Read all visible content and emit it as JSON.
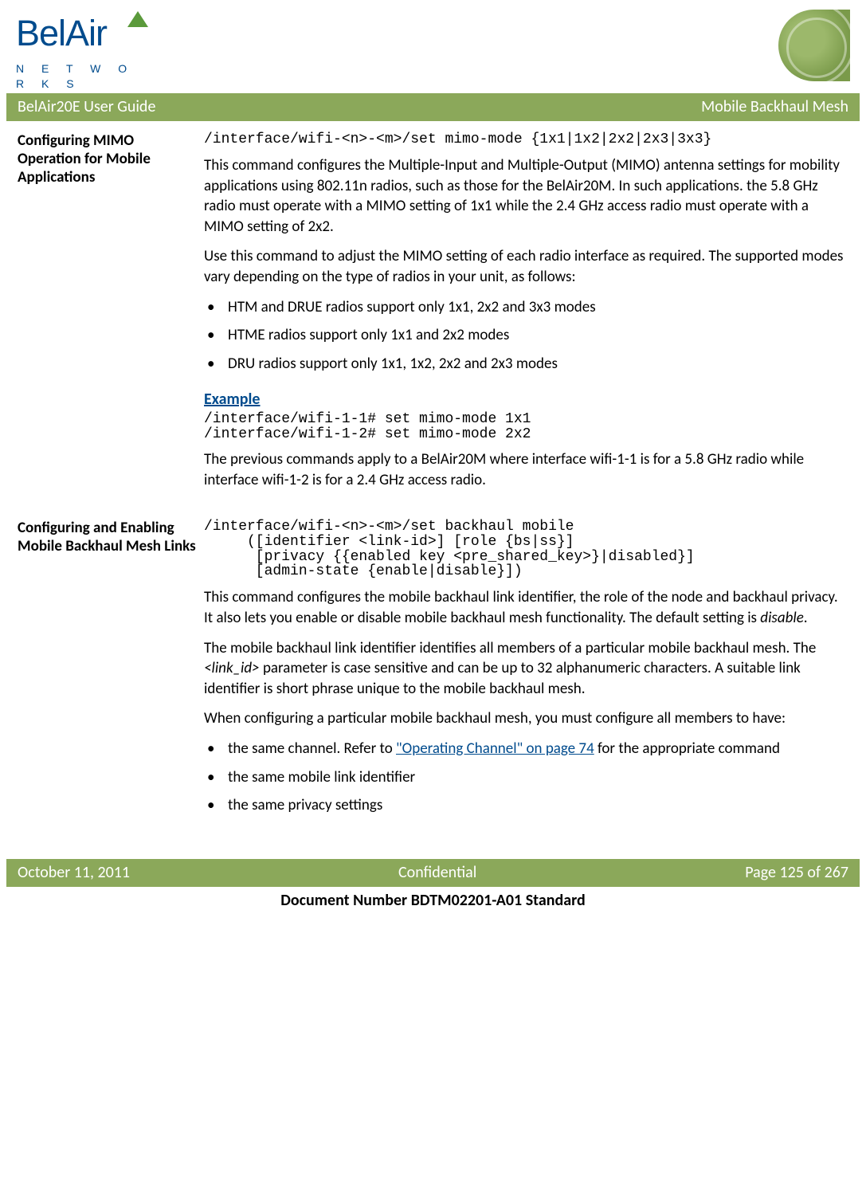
{
  "logo": {
    "brand_top": "BelAir",
    "brand_bottom": "N E T W O R K S"
  },
  "header": {
    "left": "BelAir20E User Guide",
    "right": "Mobile Backhaul Mesh"
  },
  "sec1": {
    "heading": "Configuring MIMO Operation for Mobile Applications",
    "cmd": "/interface/wifi-<n>-<m>/set mimo-mode {1x1|1x2|2x2|2x3|3x3}",
    "p1": "This command configures the Multiple-Input and Multiple-Output (MIMO) antenna settings for mobility applications using 802.11n radios, such as those for the BelAir20M. In such applications. the 5.8 GHz radio must operate with a MIMO setting of 1x1 while the 2.4 GHz access radio must operate with a MIMO setting of 2x2.",
    "p2": "Use this command to adjust the MIMO setting of each radio interface as required. The supported modes vary depending on the type of radios in your unit, as follows:",
    "b1": "HTM and DRUE radios support only 1x1, 2x2 and 3x3 modes",
    "b2": "HTME radios support only 1x1 and 2x2 modes",
    "b3": "DRU radios support only 1x1, 1x2, 2x2 and 2x3 modes",
    "example_label": "Example",
    "ex_code": "/interface/wifi-1-1# set mimo-mode 1x1\n/interface/wifi-1-2# set mimo-mode 2x2",
    "p3": "The previous commands apply to a BelAir20M where interface wifi-1-1 is for a 5.8 GHz radio while interface wifi-1-2 is for a 2.4 GHz access radio."
  },
  "sec2": {
    "heading": "Configuring and Enabling Mobile Backhaul Mesh Links",
    "cmd": "/interface/wifi-<n>-<m>/set backhaul mobile\n     ([identifier <link-id>] [role {bs|ss}]\n      [privacy {{enabled key <pre_shared_key>}|disabled}]\n      [admin-state {enable|disable}])",
    "p1a": "This command configures the mobile backhaul link identifier, the role of the node and backhaul privacy. It also lets you enable or disable mobile backhaul mesh functionality. The default setting is ",
    "p1b": "disable",
    "p1c": ".",
    "p2a": "The mobile backhaul link identifier identifies all members of a particular mobile backhaul mesh. The ",
    "p2b": "<link_id>",
    "p2c": " parameter is case sensitive and can be up to 32 alphanumeric characters. A suitable link identifier is short phrase unique to the mobile backhaul mesh.",
    "p3": "When configuring a particular mobile backhaul mesh, you must configure all members to have:",
    "b1a": "the same channel. Refer to ",
    "b1b": "\"Operating Channel\" on page 74",
    "b1c": " for the appropriate command",
    "b2": "the same mobile link identifier",
    "b3": "the same privacy settings"
  },
  "footer": {
    "left": "October 11, 2011",
    "center": "Confidential",
    "right": "Page 125 of 267"
  },
  "docnum": "Document Number BDTM02201-A01 Standard"
}
